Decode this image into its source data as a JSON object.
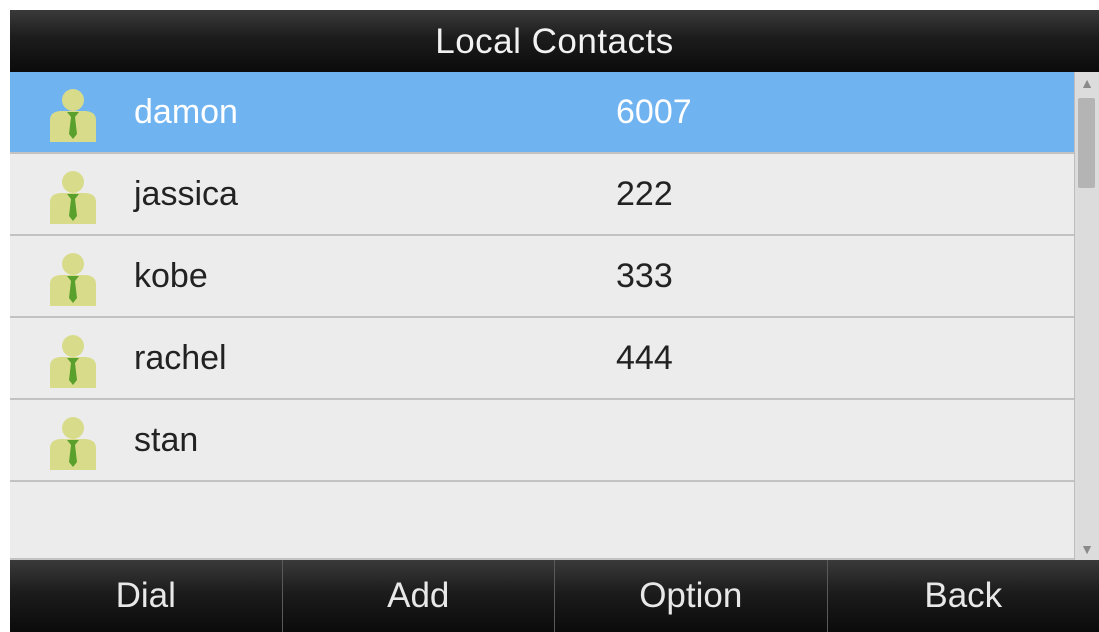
{
  "title": "Local Contacts",
  "contacts": [
    {
      "name": "damon",
      "number": "6007",
      "selected": true
    },
    {
      "name": "jassica",
      "number": "222",
      "selected": false
    },
    {
      "name": "kobe",
      "number": "333",
      "selected": false
    },
    {
      "name": "rachel",
      "number": "444",
      "selected": false
    },
    {
      "name": "stan",
      "number": "",
      "selected": false
    }
  ],
  "softkeys": {
    "dial": "Dial",
    "add": "Add",
    "option": "Option",
    "back": "Back"
  },
  "icons": {
    "contact": "contact-person-icon",
    "scroll_up": "scroll-up-arrow-icon",
    "scroll_down": "scroll-down-arrow-icon"
  },
  "colors": {
    "selected_row": "#6fb3f1",
    "avatar_body": "#d8dc8a",
    "avatar_tie": "#5aa02c"
  }
}
